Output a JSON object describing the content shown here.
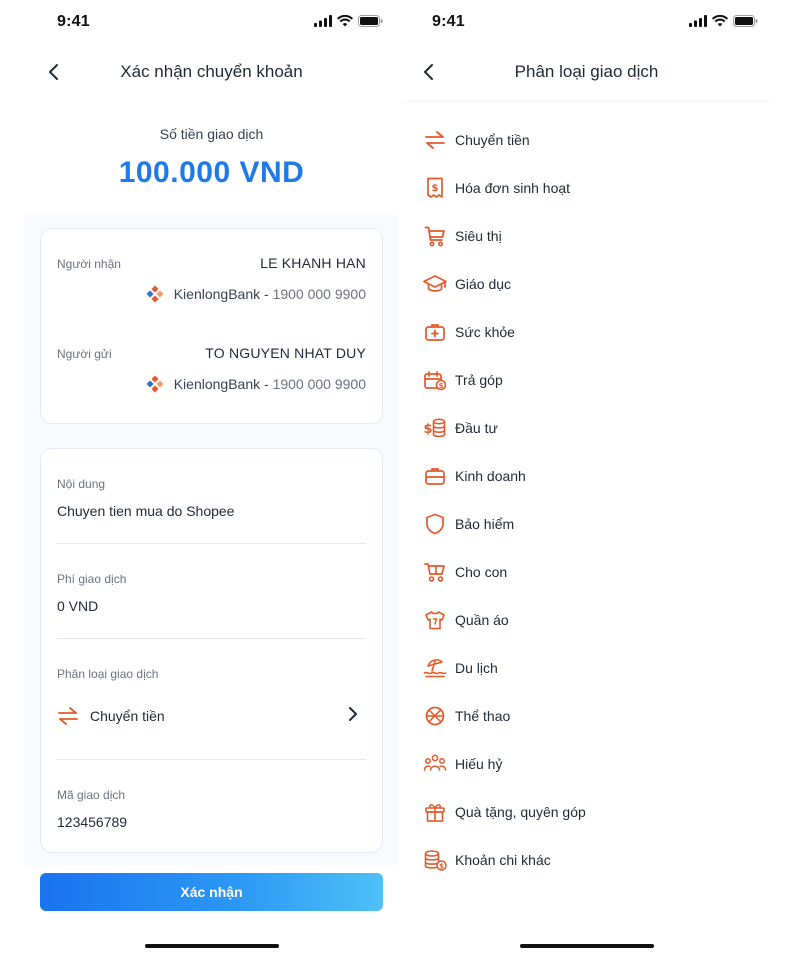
{
  "status_bar": {
    "time": "9:41"
  },
  "confirm_screen": {
    "title": "Xác nhận chuyển khoản",
    "amount_label": "Số tiền giao dịch",
    "amount": "100.000 VND",
    "recipient": {
      "label": "Người nhận",
      "name": "LE KHANH HAN",
      "bank": "KienlongBank",
      "separator": " - ",
      "phone": "1900 000 9900"
    },
    "sender": {
      "label": "Người gửi",
      "name": "TO NGUYEN NHAT DUY",
      "bank": "KienlongBank",
      "separator": " - ",
      "phone": "1900 000 9900"
    },
    "content": {
      "label": "Nội dung",
      "value": "Chuyen tien mua do Shopee"
    },
    "fee": {
      "label": "Phí giao dịch",
      "value": "0 VND"
    },
    "category": {
      "label": "Phân loại giao dịch",
      "value": "Chuyển tiền",
      "icon": "transfer-icon"
    },
    "transaction_id": {
      "label": "Mã giao dịch",
      "value": "123456789"
    },
    "confirm_label": "Xác nhận"
  },
  "category_screen": {
    "title": "Phân loại giao dịch",
    "items": [
      {
        "label": "Chuyển tiền",
        "icon": "transfer-icon"
      },
      {
        "label": "Hóa đơn sinh hoạt",
        "icon": "receipt-icon"
      },
      {
        "label": "Siêu thị",
        "icon": "cart-icon"
      },
      {
        "label": "Giáo dục",
        "icon": "graduation-cap-icon"
      },
      {
        "label": "Sức khỏe",
        "icon": "medical-kit-icon"
      },
      {
        "label": "Trả góp",
        "icon": "installment-icon"
      },
      {
        "label": "Đầu tư",
        "icon": "coin-stack-icon"
      },
      {
        "label": "Kinh doanh",
        "icon": "briefcase-icon"
      },
      {
        "label": "Bảo hiểm",
        "icon": "shield-icon"
      },
      {
        "label": "Cho con",
        "icon": "stroller-icon"
      },
      {
        "label": "Quần áo",
        "icon": "shirt-icon"
      },
      {
        "label": "Du lịch",
        "icon": "beach-umbrella-icon"
      },
      {
        "label": "Thể thao",
        "icon": "ball-icon"
      },
      {
        "label": "Hiếu hỷ",
        "icon": "people-icon"
      },
      {
        "label": "Quà tặng, quyên góp",
        "icon": "gift-icon"
      },
      {
        "label": "Khoản chi khác",
        "icon": "database-coin-icon"
      }
    ]
  },
  "colors": {
    "accent": "#1e7ae6",
    "icon": "#e05a2b",
    "button_start": "#1a73f0",
    "button_end": "#4fc0f7"
  }
}
